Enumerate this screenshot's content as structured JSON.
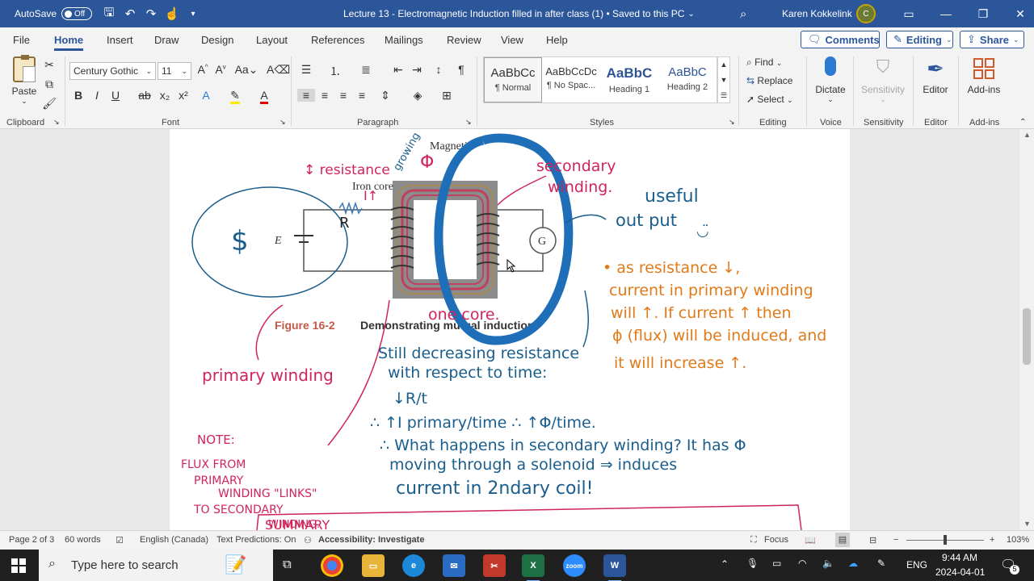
{
  "titlebar": {
    "autosave_label": "AutoSave",
    "autosave_state": "Off",
    "doc_title": "Lecture 13 - Electromagnetic Induction filled in after class (1) • Saved to this PC",
    "user_name": "Karen Kokkelink",
    "avatar_initials": "C"
  },
  "menu": {
    "tabs": [
      "File",
      "Home",
      "Insert",
      "Draw",
      "Design",
      "Layout",
      "References",
      "Mailings",
      "Review",
      "View",
      "Help"
    ],
    "comments": "Comments",
    "editing": "Editing",
    "share": "Share"
  },
  "ribbon": {
    "clipboard": {
      "paste": "Paste",
      "label": "Clipboard"
    },
    "font": {
      "family": "Century Gothic",
      "size": "11",
      "label": "Font"
    },
    "paragraph": {
      "label": "Paragraph"
    },
    "styles": {
      "label": "Styles",
      "items": [
        {
          "sample": "AaBbCc",
          "name": "¶ Normal"
        },
        {
          "sample": "AaBbCcDc",
          "name": "¶ No Spac..."
        },
        {
          "sample": "AaBbC",
          "name": "Heading 1"
        },
        {
          "sample": "AaBbC",
          "name": "Heading 2"
        }
      ]
    },
    "editing": {
      "find": "Find",
      "replace": "Replace",
      "select": "Select",
      "label": "Editing"
    },
    "voice": {
      "dictate": "Dictate",
      "label": "Voice"
    },
    "sensitivity": {
      "button": "Sensitivity",
      "label": "Sensitivity"
    },
    "editor": {
      "button": "Editor",
      "label": "Editor"
    },
    "addins": {
      "button": "Add-ins",
      "label": "Add-ins"
    }
  },
  "document": {
    "figure_labels": {
      "iron_core": "Iron core",
      "magnetic": "Magnetic",
      "caption_num": "Figure 16-2",
      "caption_text": "Demonstrating mutual induction",
      "E": "E",
      "G": "G",
      "R": "R"
    },
    "ink": {
      "resistance": "↕ resistance",
      "I_up": "I↑",
      "growing": "growing",
      "phi": "Φ",
      "secondary_1": "secondary",
      "secondary_2": "winding.",
      "useful_1": "useful",
      "useful_2": "out put",
      "one_core": "one core.",
      "primary": "primary winding",
      "orange_1": "• as resistance ↓,",
      "orange_2": "current in primary winding",
      "orange_3": "will ↑.  If current ↑ then",
      "orange_4": "ϕ (flux) will be induced, and",
      "orange_5": "it will increase ↑.",
      "blue_1": "Still decreasing resistance",
      "blue_2": "with respect to time:",
      "blue_3": "↓R/t",
      "blue_4": "∴ ↑I primary/time  ∴ ↑Φ/time.",
      "blue_5": "∴ What happens in secondary winding?  It has Φ",
      "blue_6": "moving through a solenoid ⇒ induces",
      "blue_7": "current in 2ndary coil!",
      "note_1": "NOTE:",
      "note_2": "FLUX FROM",
      "note_3": "PRIMARY",
      "note_4": "WINDING  \"LINKS\"",
      "note_5": "TO SECONDARY",
      "note_6": "WINDING.",
      "summary": "SUMMARY"
    }
  },
  "status": {
    "page": "Page 2 of 3",
    "words": "60 words",
    "language": "English (Canada)",
    "predictions": "Text Predictions: On",
    "accessibility": "Accessibility: Investigate",
    "focus": "Focus",
    "zoom": "103%"
  },
  "taskbar": {
    "search_placeholder": "Type here to search",
    "lang": "ENG",
    "time": "9:44 AM",
    "date": "2024-04-01",
    "notif_count": "5"
  },
  "colors": {
    "word_blue": "#2b579a",
    "ink_red": "#d0245a",
    "ink_orange": "#e07a1a",
    "ink_blue": "#1a5e8c",
    "ink_bigblue": "#1f6fb8"
  }
}
